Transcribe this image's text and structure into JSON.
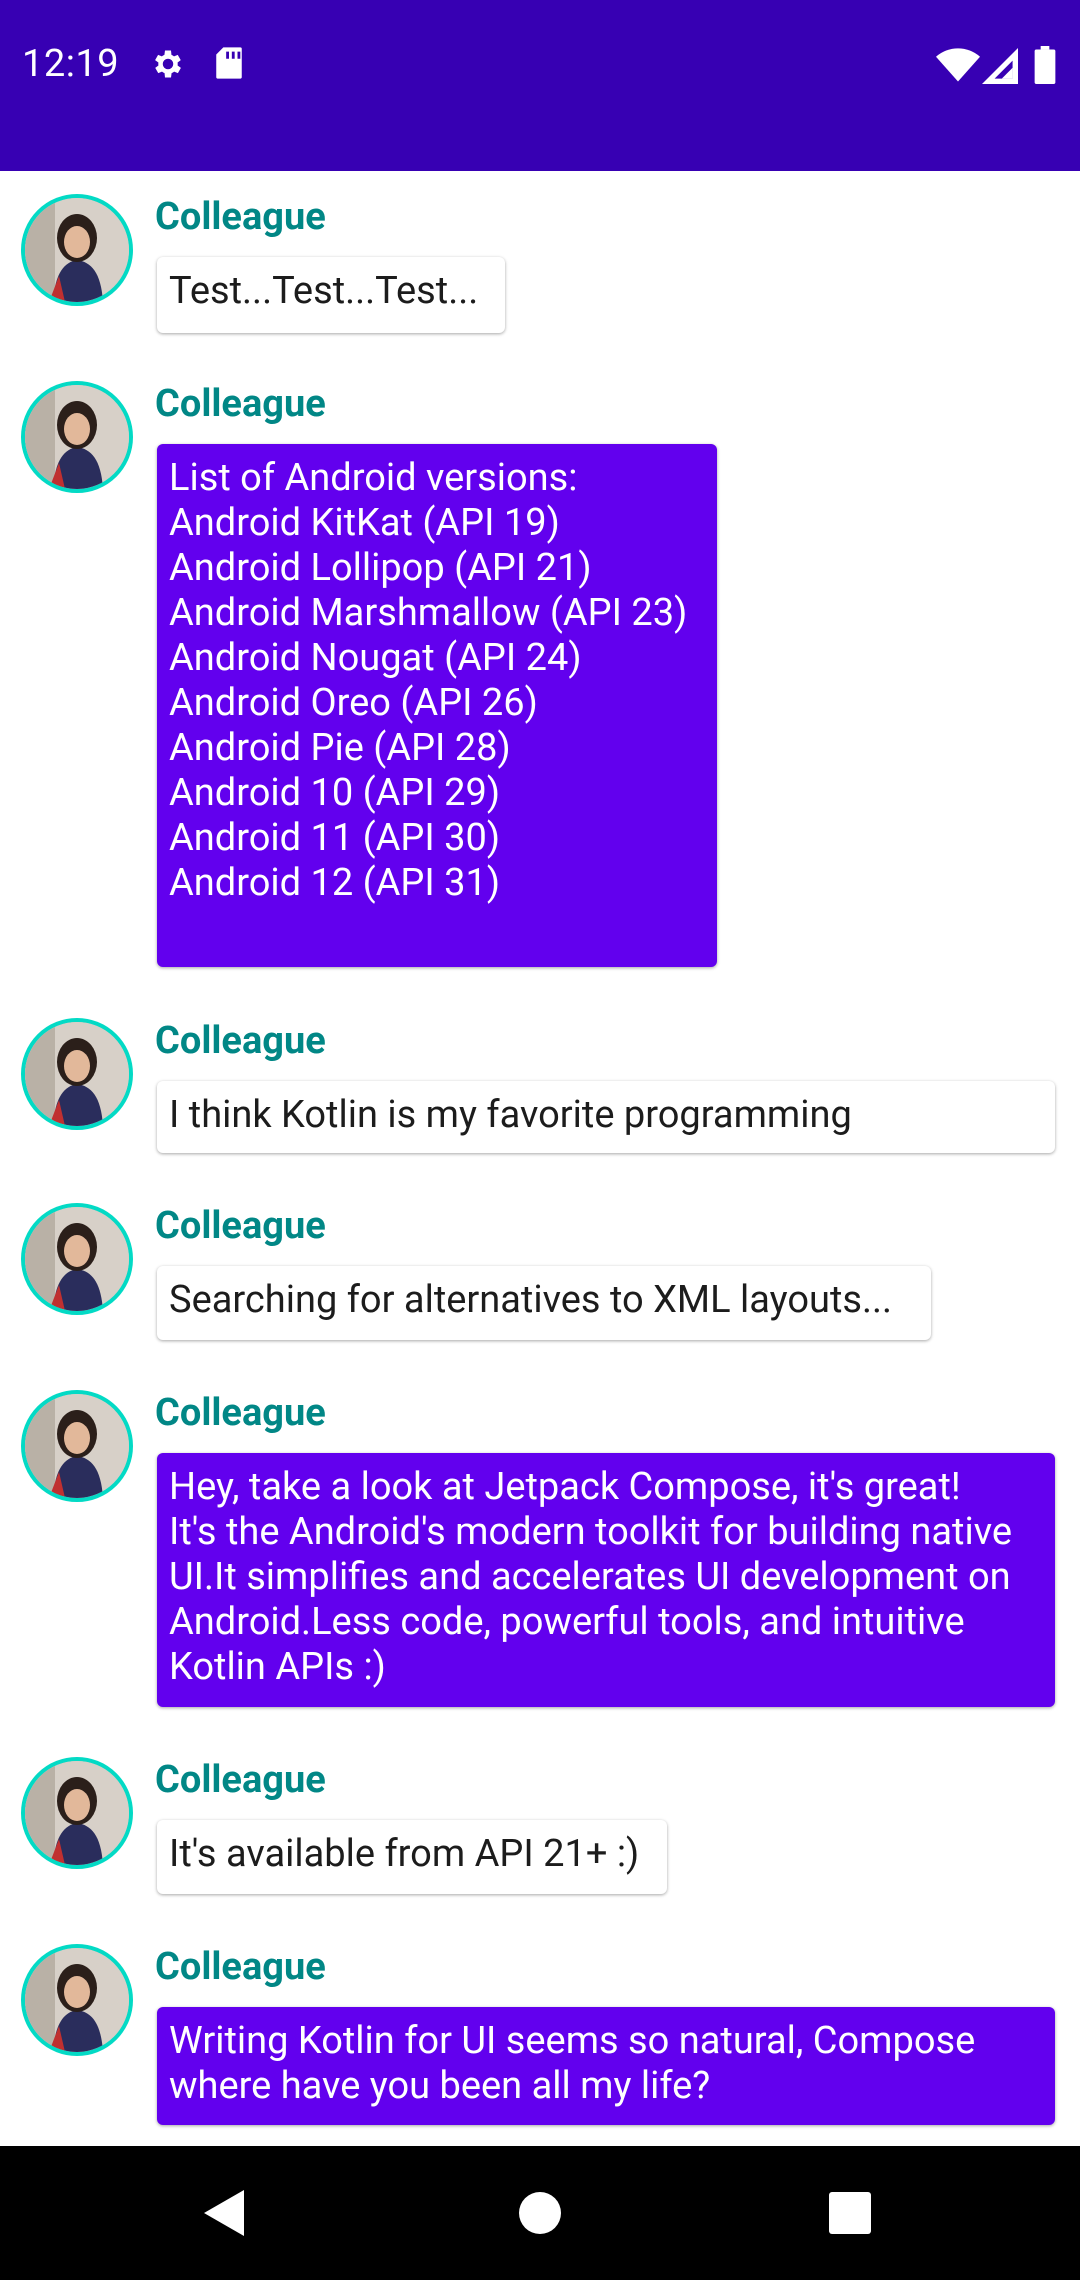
{
  "status_bar": {
    "time": "12:19",
    "icons_left": [
      "gear-icon",
      "sd-card-icon"
    ],
    "icons_right": [
      "wifi-icon",
      "cellular-signal-icon",
      "battery-icon"
    ],
    "background": "#3700B3"
  },
  "messages": [
    {
      "sender": "Colleague",
      "style": "plain",
      "lines": [
        "Test...Test...Test..."
      ]
    },
    {
      "sender": "Colleague",
      "style": "purple",
      "lines": [
        "List of Android versions:",
        "Android KitKat (API 19)",
        "Android Lollipop (API 21)",
        "Android Marshmallow (API 23)",
        "Android Nougat (API 24)",
        "Android Oreo (API 26)",
        "Android Pie (API 28)",
        "Android 10 (API 29)",
        "Android 11 (API 30)",
        "Android 12 (API 31)",
        ""
      ]
    },
    {
      "sender": "Colleague",
      "style": "plain",
      "lines": [
        "I think Kotlin is my favorite programming"
      ]
    },
    {
      "sender": "Colleague",
      "style": "plain",
      "lines": [
        "Searching for alternatives to XML layouts..."
      ]
    },
    {
      "sender": "Colleague",
      "style": "purple",
      "lines": [
        "Hey, take a look at Jetpack Compose, it's great!",
        "It's the Android's modern toolkit for building native",
        "UI.It simplifies and accelerates UI development on",
        "Android.Less code, powerful tools, and intuitive",
        "Kotlin APIs :)"
      ]
    },
    {
      "sender": "Colleague",
      "style": "plain",
      "lines": [
        "It's available from API 21+ :)"
      ]
    },
    {
      "sender": "Colleague",
      "style": "purple",
      "lines": [
        "Writing Kotlin for UI seems so natural, Compose",
        "where have you been all my life?"
      ]
    }
  ],
  "colors": {
    "sender_name": "#018786",
    "avatar_border": "#03DAC5",
    "purple_bubble": "#6200EE"
  },
  "nav_bar": {
    "buttons": [
      "back-icon",
      "home-icon",
      "recents-icon"
    ]
  }
}
